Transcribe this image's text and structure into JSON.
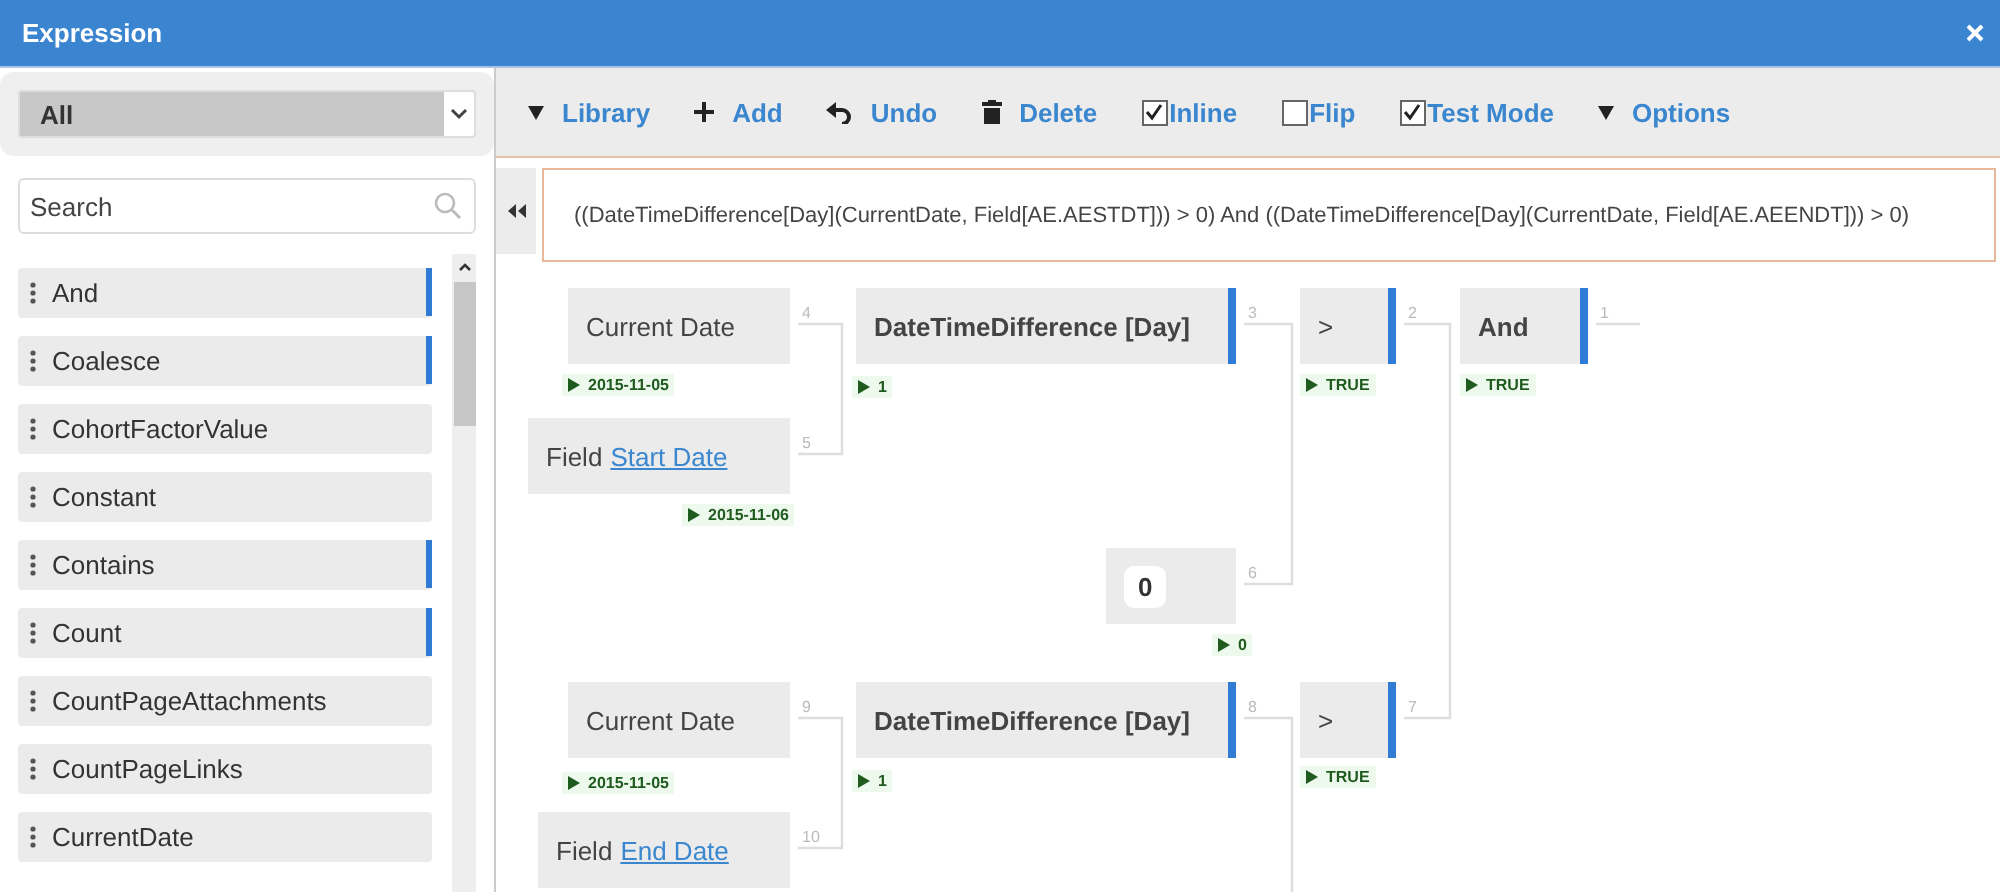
{
  "window": {
    "title": "Expression"
  },
  "sidebar": {
    "category": "All",
    "search": {
      "placeholder": "Search"
    },
    "items": [
      {
        "label": "And",
        "marked": true
      },
      {
        "label": "Coalesce",
        "marked": true
      },
      {
        "label": "CohortFactorValue",
        "marked": false
      },
      {
        "label": "Constant",
        "marked": false
      },
      {
        "label": "Contains",
        "marked": true
      },
      {
        "label": "Count",
        "marked": true
      },
      {
        "label": "CountPageAttachments",
        "marked": false
      },
      {
        "label": "CountPageLinks",
        "marked": false
      },
      {
        "label": "CurrentDate",
        "marked": false
      }
    ]
  },
  "toolbar": [
    {
      "kind": "menu",
      "label": "Library"
    },
    {
      "kind": "add",
      "label": "Add"
    },
    {
      "kind": "undo",
      "label": "Undo"
    },
    {
      "kind": "delete",
      "label": "Delete"
    },
    {
      "kind": "checkbox",
      "label": "Inline",
      "checked": true
    },
    {
      "kind": "checkbox",
      "label": "Flip",
      "checked": false
    },
    {
      "kind": "checkbox",
      "label": "Test Mode",
      "checked": true
    },
    {
      "kind": "menu",
      "label": "Options"
    }
  ],
  "expression": "((DateTimeDifference[Day](CurrentDate, Field[AE.AESTDT])) > 0) And ((DateTimeDifference[Day](CurrentDate, Field[AE.AEENDT])) > 0)",
  "nodes": [
    {
      "kind": "plain",
      "label": "Current Date",
      "port": "4",
      "result": "2015-11-05"
    },
    {
      "kind": "field",
      "label": "Field",
      "link": "Start Date",
      "port": "5",
      "result": "2015-11-06"
    },
    {
      "kind": "function",
      "label": "DateTimeDifference [Day]",
      "port": "3",
      "result": "1"
    },
    {
      "kind": "constant",
      "label": "0",
      "port": "6",
      "result": "0"
    },
    {
      "kind": "operator",
      "label": ">",
      "port": "2",
      "result": "TRUE"
    },
    {
      "kind": "function",
      "label": "And",
      "port": "1",
      "result": "TRUE"
    },
    {
      "kind": "plain",
      "label": "Current Date",
      "port": "9",
      "result": "2015-11-05"
    },
    {
      "kind": "field",
      "label": "Field",
      "link": "End Date",
      "port": "10"
    },
    {
      "kind": "function",
      "label": "DateTimeDifference [Day]",
      "port": "8",
      "result": "1"
    },
    {
      "kind": "operator",
      "label": ">",
      "port": "7",
      "result": "TRUE"
    }
  ]
}
